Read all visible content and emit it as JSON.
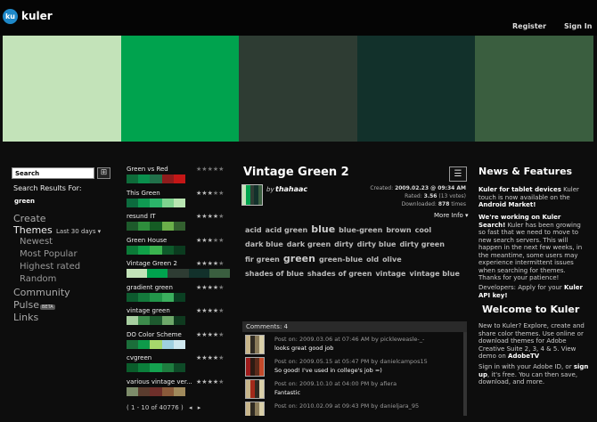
{
  "header": {
    "logo": "ku",
    "brand": "kuler",
    "register": "Register",
    "signin": "Sign In"
  },
  "hero_colors": [
    "#c3e3b9",
    "#00a34e",
    "#2e3c33",
    "#12312b",
    "#3a5e3f"
  ],
  "search": {
    "placeholder": "Search",
    "results_label": "Search Results For:",
    "term": "green",
    "button_icon": "grid-icon"
  },
  "nav": {
    "create": "Create",
    "themes": "Themes",
    "themes_filter": "Last 30 days ▾",
    "newest": "Newest",
    "most_popular": "Most Popular",
    "highest_rated": "Highest rated",
    "random": "Random",
    "community": "Community",
    "pulse": "Pulse",
    "pulse_badge": "BETA",
    "links": "Links"
  },
  "themes": [
    {
      "name": "Green vs Red",
      "rating": 0,
      "colors": [
        "#0e6b3a",
        "#0a8f4d",
        "#21704a",
        "#8f1c1c",
        "#c41616"
      ]
    },
    {
      "name": "This Green",
      "rating": 3,
      "colors": [
        "#0c6b3e",
        "#0f9a52",
        "#2bb56a",
        "#7ed38f",
        "#b9e6b2"
      ]
    },
    {
      "name": "resund IT",
      "rating": 4,
      "colors": [
        "#1d5a2b",
        "#2e8d3c",
        "#155c24",
        "#6bb04a",
        "#33602f"
      ]
    },
    {
      "name": "Green House",
      "rating": 3,
      "colors": [
        "#0b7a37",
        "#10a048",
        "#3ab44f",
        "#0e5a2b",
        "#0b3b1f"
      ]
    },
    {
      "name": "Vintage Green 2",
      "rating": 4,
      "colors": [
        "#c3e3b9",
        "#00a34e",
        "#2e3c33",
        "#12312b",
        "#3a5e3f"
      ],
      "wide": true
    },
    {
      "name": "gradient green",
      "rating": 4,
      "colors": [
        "#0d5a2e",
        "#147a3c",
        "#22964a",
        "#3bb05e",
        "#0a3f22"
      ]
    },
    {
      "name": "vintage green",
      "rating": 4,
      "colors": [
        "#a7cfa0",
        "#3d8b4c",
        "#1e5a2f",
        "#6ea86a",
        "#0f3a1f"
      ]
    },
    {
      "name": "DO  Color Scheme",
      "rating": 4,
      "colors": [
        "#1b6e3a",
        "#0e9a4a",
        "#a6d86b",
        "#9fd0e0",
        "#cfe8ef"
      ]
    },
    {
      "name": "cvgreen",
      "rating": 4,
      "colors": [
        "#0a5d2b",
        "#0b7f3b",
        "#14a24f",
        "#1e7d3f",
        "#0e4a27"
      ]
    },
    {
      "name": "various vintage ver...",
      "rating": 4,
      "colors": [
        "#7d8c6a",
        "#5a3c2e",
        "#6e2f2a",
        "#8a5a3a",
        "#a08a5c"
      ]
    }
  ],
  "pager": {
    "text": "( 1 - 10 of 40776 )",
    "prev": "◂",
    "next": "▸"
  },
  "detail": {
    "title": "Vintage Green 2",
    "by": "by",
    "author": "thahaac",
    "created_label": "Created:",
    "created": "2009.02.23 @ 09:34 AM",
    "rated_label": "Rated:",
    "rated": "3.56",
    "votes": "(13 votes)",
    "downloaded_label": "Downloaded:",
    "downloaded": "878",
    "times": "times",
    "more_info": "More Info ▾",
    "tags": [
      {
        "t": "acid"
      },
      {
        "t": "acid green"
      },
      {
        "t": "blue",
        "big": true
      },
      {
        "t": "blue-green"
      },
      {
        "t": "brown"
      },
      {
        "t": "cool"
      },
      {
        "t": "dark blue"
      },
      {
        "t": "dark green"
      },
      {
        "t": "dirty"
      },
      {
        "t": "dirty blue"
      },
      {
        "t": "dirty green"
      },
      {
        "t": "fir green"
      },
      {
        "t": "green",
        "big": true
      },
      {
        "t": "green-blue"
      },
      {
        "t": "old"
      },
      {
        "t": "olive"
      },
      {
        "t": "shades of blue"
      },
      {
        "t": "shades of green"
      },
      {
        "t": "vintage"
      },
      {
        "t": "vintage blue"
      }
    ]
  },
  "comments": {
    "header": "Comments: 4",
    "items": [
      {
        "meta": "Post on: 2009.03.06 at 07:46 AM by pickleweasle-_-",
        "text": "looks great good job",
        "colors": [
          "#c7b58a",
          "#2f2a22",
          "#8a7b5a",
          "#d9cfa8"
        ]
      },
      {
        "meta": "Post on: 2009.05.15 at 05:47 PM by danielcampos15",
        "text": "So good! I've used in college's job =)",
        "colors": [
          "#9e1c1c",
          "#2c1a12",
          "#5a2a1a",
          "#c44a2a"
        ]
      },
      {
        "meta": "Post on: 2009.10.10 at 04:00 PM by afiera",
        "text": "Fantastic",
        "colors": [
          "#c7b58a",
          "#a22a1a",
          "#2f2a22",
          "#d9cfa8"
        ]
      },
      {
        "meta": "Post on: 2010.02.09 at 09:43 PM by danieljara_95",
        "text": "...",
        "colors": [
          "#c7b58a",
          "#2f2a22",
          "#8a7b5a",
          "#d9cfa8"
        ]
      }
    ]
  },
  "news": {
    "title": "News & Features",
    "p1_bold": "Kuler for tablet devices",
    "p1": " Kuler touch is now available on the ",
    "p1_bold2": "Android Market!",
    "p2_bold": "We're working on Kuler Search!",
    "p2": " Kuler has been growing so fast that we need to move to new search servers. This will happen in the next few weeks, in the meantime, some users may experience intermittent issues when searching for themes. Thanks for your patience!",
    "p3": "Developers: Apply for your ",
    "p3_bold": "Kuler API key!"
  },
  "welcome": {
    "title": "Welcome to Kuler",
    "p1": "New to Kuler? Explore, create and share color themes. Use online or download themes for Adobe Creative Suite 2, 3, 4 & 5. View demo on ",
    "p1_bold": "AdobeTV",
    "p2": "Sign in with your Adobe ID, or ",
    "p2_bold": "sign up",
    "p2b": ", it's free. You can then save, download, and more."
  }
}
